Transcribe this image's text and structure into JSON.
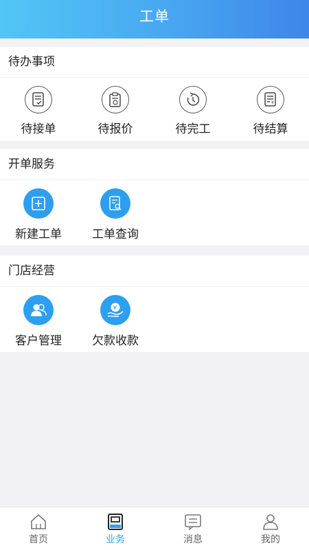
{
  "header": {
    "title": "工单"
  },
  "pending": {
    "title": "待办事项",
    "items": [
      {
        "label": "待接单",
        "icon": "document-check-icon"
      },
      {
        "label": "待报价",
        "icon": "clipboard-price-icon"
      },
      {
        "label": "待完工",
        "icon": "clock-refresh-icon"
      },
      {
        "label": "待结算",
        "icon": "document-yen-icon"
      }
    ]
  },
  "order_service": {
    "title": "开单服务",
    "items": [
      {
        "label": "新建工单",
        "icon": "plus-square-icon"
      },
      {
        "label": "工单查询",
        "icon": "document-search-icon"
      }
    ]
  },
  "store": {
    "title": "门店经营",
    "items": [
      {
        "label": "客户管理",
        "icon": "users-icon"
      },
      {
        "label": "欠款收款",
        "icon": "yen-hand-icon"
      }
    ]
  },
  "tabbar": {
    "active": "业务",
    "active_color": "#2d9ff0",
    "items": [
      {
        "label": "首页",
        "icon": "home-icon"
      },
      {
        "label": "业务",
        "icon": "business-icon"
      },
      {
        "label": "消息",
        "icon": "message-icon"
      },
      {
        "label": "我的",
        "icon": "person-icon"
      }
    ]
  }
}
